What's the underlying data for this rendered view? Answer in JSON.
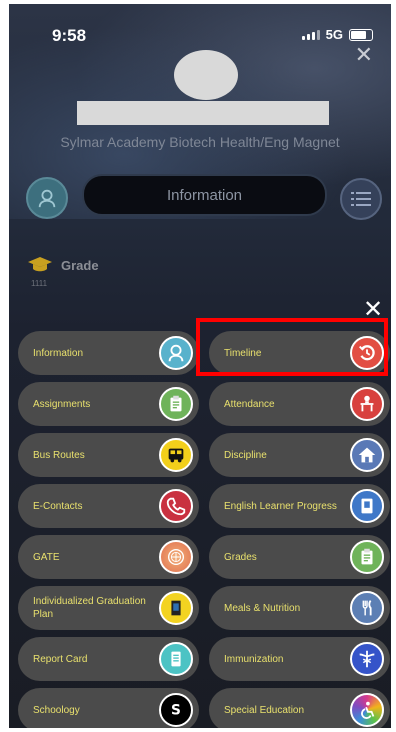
{
  "status_bar": {
    "time": "9:58",
    "network": "5G"
  },
  "header": {
    "school": "Sylmar Academy Biotech Health/Eng Magnet"
  },
  "nav": {
    "info_label": "Information"
  },
  "grade": {
    "label": "Grade",
    "sub": "1111"
  },
  "menu": {
    "items": [
      {
        "label": "Information",
        "icon": "student-icon",
        "color": "#58b2cc"
      },
      {
        "label": "Timeline",
        "icon": "history-icon",
        "color": "#e24e43"
      },
      {
        "label": "Assignments",
        "icon": "clipboard-icon",
        "color": "#6fb35a"
      },
      {
        "label": "Attendance",
        "icon": "desk-icon",
        "color": "#d8413e"
      },
      {
        "label": "Bus Routes",
        "icon": "bus-icon",
        "color": "#f2cf1b"
      },
      {
        "label": "Discipline",
        "icon": "home-icon",
        "color": "#5a79b6"
      },
      {
        "label": "E-Contacts",
        "icon": "phone-icon",
        "color": "#c93140"
      },
      {
        "label": "English Learner Progress",
        "icon": "book-icon",
        "color": "#3f78c8"
      },
      {
        "label": "GATE",
        "icon": "seal-icon",
        "color": "#e8895c"
      },
      {
        "label": "Grades",
        "icon": "clipboard-icon",
        "color": "#6fb35a"
      },
      {
        "label": "Individualized Graduation Plan",
        "icon": "document-icon",
        "color": "#f3d321"
      },
      {
        "label": "Meals & Nutrition",
        "icon": "utensils-icon",
        "color": "#5c7fb4"
      },
      {
        "label": "Report Card",
        "icon": "report-icon",
        "color": "#4cc3c4"
      },
      {
        "label": "Immunization",
        "icon": "caduceus-icon",
        "color": "#3554c9"
      },
      {
        "label": "Schoology",
        "icon": "schoology-icon",
        "color": "#000000"
      },
      {
        "label": "Special Education",
        "icon": "accessibility-icon",
        "color": "#d6398c"
      }
    ]
  }
}
